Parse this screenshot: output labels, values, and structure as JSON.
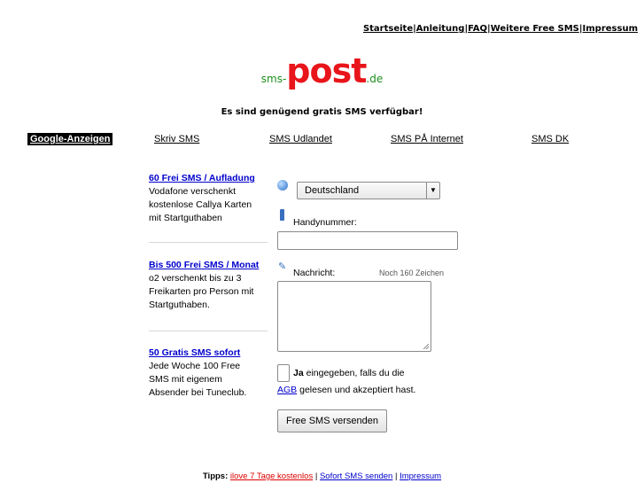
{
  "topnav": {
    "items": [
      "Startseite",
      "Anleitung",
      "FAQ",
      "Weitere Free SMS",
      "Impressum"
    ],
    "separator": "|"
  },
  "logo": {
    "prefix": "sms-",
    "main": "post",
    "suffix": ".de"
  },
  "status": "Es sind genügend gratis SMS verfügbar!",
  "adbar": {
    "label": "Google-Anzeigen",
    "links": [
      "Skriv SMS",
      "SMS Udlandet",
      "SMS PÅ Internet",
      "SMS DK"
    ]
  },
  "ads": [
    {
      "title": "60 Frei SMS / Aufladung",
      "lines": [
        "Vodafone verschenkt",
        "kostenlose Callya Karten",
        "mit Startguthaben"
      ]
    },
    {
      "title": "Bis 500 Frei SMS / Monat",
      "lines": [
        "o2 verschenkt bis zu 3",
        "Freikarten pro Person mit",
        "Startguthaben."
      ]
    },
    {
      "title": "50 Gratis SMS sofort",
      "lines": [
        "Jede Woche 100 Free",
        "SMS mit eigenem",
        "Absender bei Tuneclub."
      ]
    }
  ],
  "form": {
    "country": "Deutschland",
    "phone_label": "Handynummer:",
    "phone_value": "",
    "message_label": "Nachricht:",
    "counter": "Noch 160 Zeichen",
    "message_value": "",
    "agree_bold": "Ja",
    "agree_text1": " eingegeben, falls du die",
    "agree_link": "AGB",
    "agree_text2": " gelesen und akzeptiert hast.",
    "send_label": "Free SMS versenden"
  },
  "footer": {
    "label": "Tipps:",
    "links": [
      "ilove 7 Tage kostenlos",
      "Sofort SMS senden",
      "Impressum"
    ],
    "separator": " | "
  },
  "colors": {
    "logo_red": "#e8151b",
    "logo_green": "#1c8f1c",
    "link_blue": "#0000cc",
    "tip_red": "#dd0000"
  }
}
